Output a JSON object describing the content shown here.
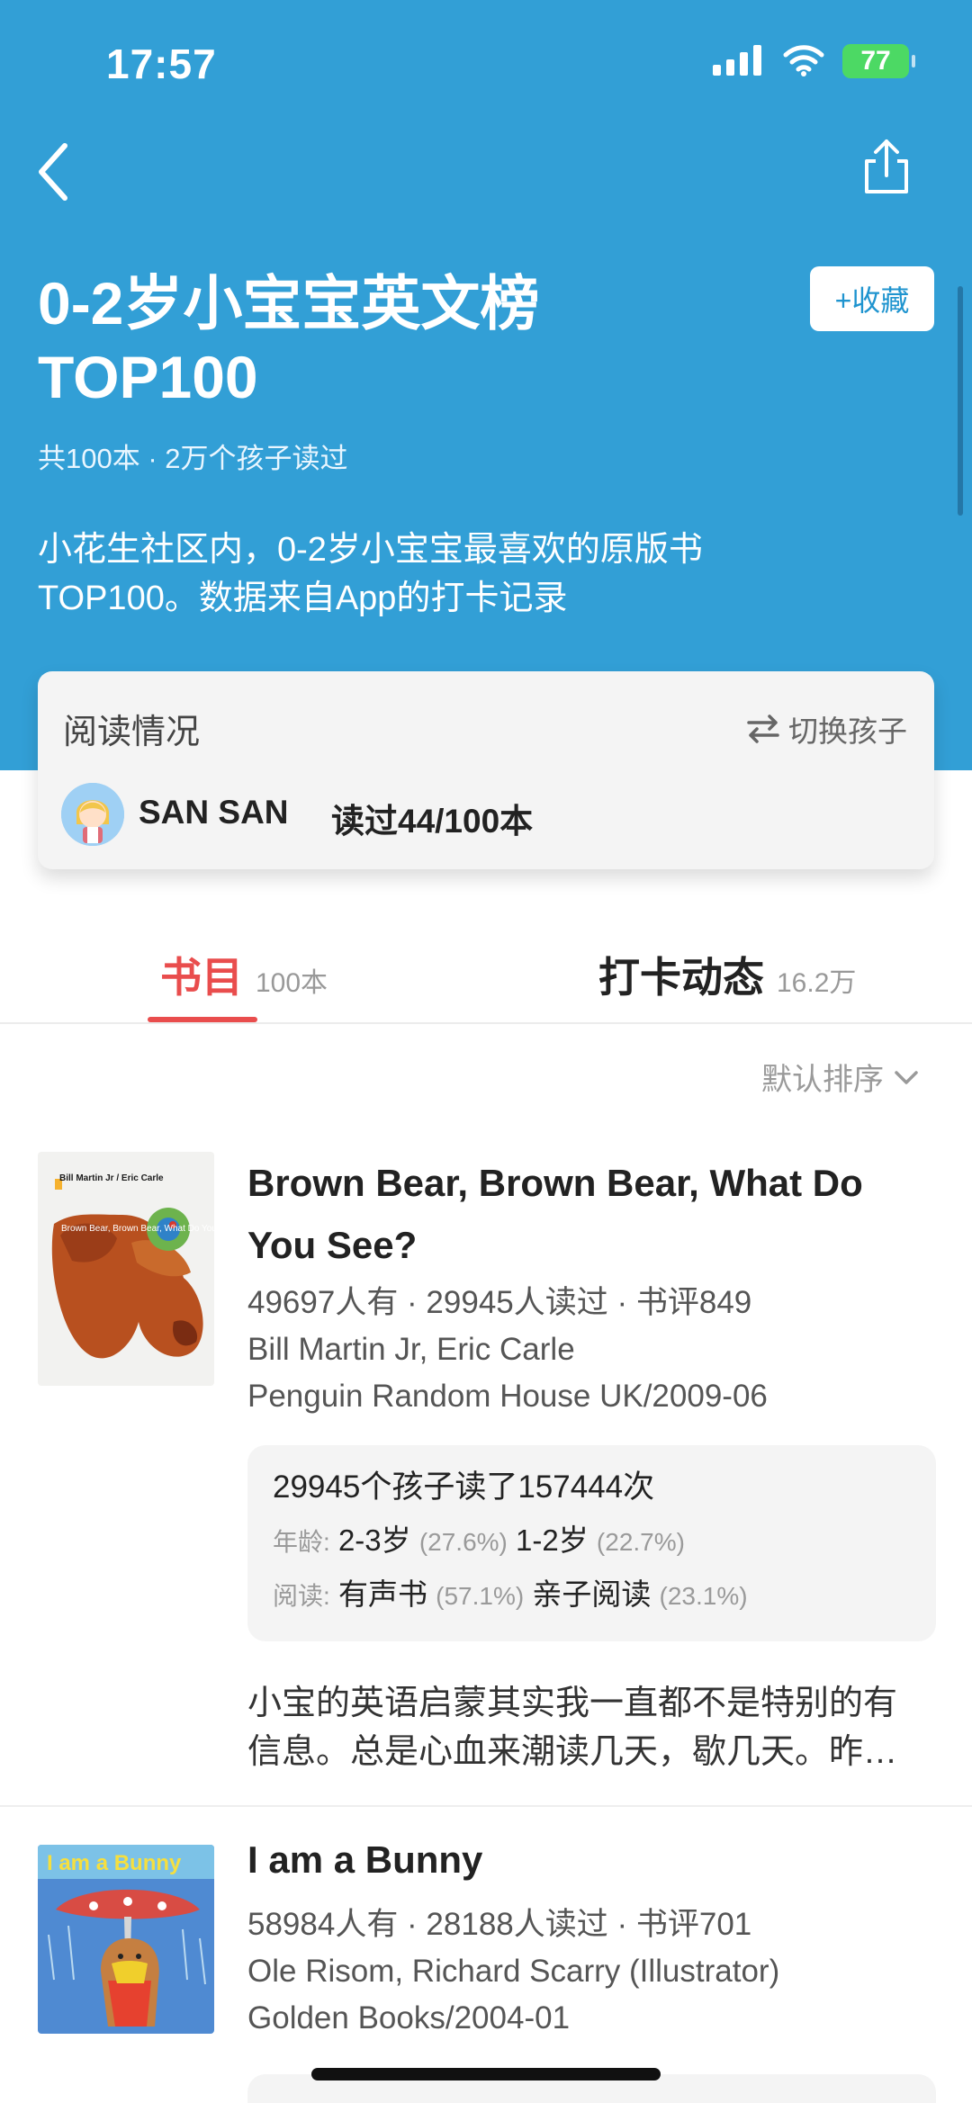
{
  "status_bar": {
    "time": "17:57",
    "battery": "77"
  },
  "header": {
    "title_line1": "0-2岁小宝宝英文榜",
    "title_line2": "TOP100",
    "collect_label": "+收藏",
    "meta": "共100本 · 2万个孩子读过",
    "description_line1": "小花生社区内，0-2岁小宝宝最喜欢的原版书",
    "description_line2": "TOP100。数据来自App的打卡记录"
  },
  "reading_card": {
    "title": "阅读情况",
    "switch_label": "切换孩子",
    "child_name": "SAN SAN",
    "read_status": "读过44/100本"
  },
  "tabs": [
    {
      "label": "书目",
      "count": "100本"
    },
    {
      "label": "打卡动态",
      "count": "16.2万"
    }
  ],
  "sort": {
    "label": "默认排序"
  },
  "books": [
    {
      "title_line1": "Brown Bear, Brown Bear, What Do",
      "title_line2": "You See?",
      "stats": "49697人有 · 29945人读过 · 书评849",
      "authors": "Bill Martin Jr, Eric Carle",
      "publisher": "Penguin Random House UK/2009-06",
      "cover_author_text": "Bill Martin Jr / Eric Carle",
      "cover_title_text": "Brown Bear, Brown Bear, What Do You See?",
      "reading_summary": "29945个孩子读了157444次",
      "age_label": "年龄:",
      "age_1": "2-3岁",
      "age_1_pct": "(27.6%)",
      "age_2": "1-2岁",
      "age_2_pct": "(22.7%)",
      "mode_label": "阅读:",
      "mode_1": "有声书",
      "mode_1_pct": "(57.1%)",
      "mode_2": "亲子阅读",
      "mode_2_pct": "(23.1%)",
      "review_line1": "小宝的英语启蒙其实我一直都不是特别的有",
      "review_line2": "信息。总是心血来潮读几天，歇几天。昨…"
    },
    {
      "title": "I am a Bunny",
      "stats": "58984人有 · 28188人读过 · 书评701",
      "authors": "Ole Risom, Richard Scarry (Illustrator)",
      "publisher": "Golden Books/2004-01",
      "cover_title_text": "I am a Bunny"
    }
  ],
  "colors": {
    "header_blue": "#329fd6",
    "accent_red": "#e94d4d",
    "collect_blue": "#1f94cf"
  },
  "icons": {
    "back": "back-arrow-icon",
    "share": "share-icon",
    "switch": "switch-arrows-icon",
    "sort": "chevron-down-icon",
    "signal": "signal-icon",
    "wifi": "wifi-icon",
    "battery": "battery-icon"
  }
}
